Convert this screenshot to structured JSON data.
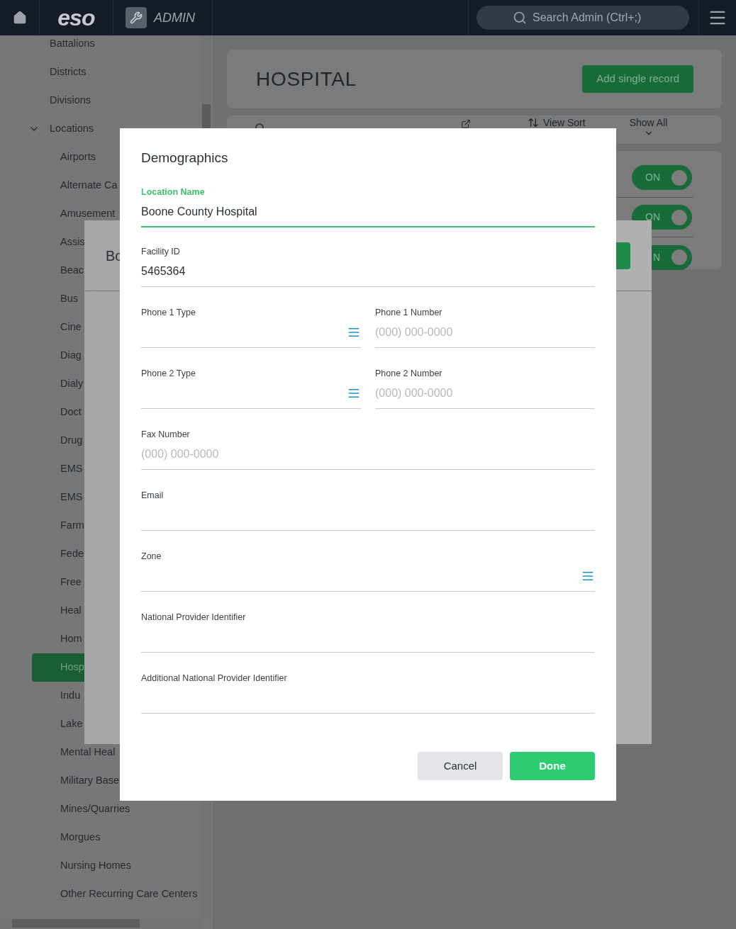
{
  "header": {
    "logo": "eso",
    "app_label": "ADMIN",
    "search": {
      "placeholder": "Search Admin (Ctrl+;)"
    }
  },
  "sidebar": {
    "items": [
      {
        "label": "Battalions",
        "selected": false
      },
      {
        "label": "Districts",
        "selected": false
      },
      {
        "label": "Divisions",
        "selected": false
      },
      {
        "label": "Locations",
        "selected": false,
        "expanded": true,
        "children": [
          {
            "label": "Airports",
            "selected": false
          },
          {
            "label": "Alternate Ca",
            "selected": false
          },
          {
            "label": "Amusement",
            "selected": false
          },
          {
            "label": "Assis",
            "selected": false
          },
          {
            "label": "Beac",
            "selected": false
          },
          {
            "label": "Bus",
            "selected": false
          },
          {
            "label": "Cine",
            "selected": false
          },
          {
            "label": "Diag",
            "selected": false
          },
          {
            "label": "Dialy",
            "selected": false
          },
          {
            "label": "Doct",
            "selected": false
          },
          {
            "label": "Drug",
            "selected": false
          },
          {
            "label": "EMS",
            "selected": false
          },
          {
            "label": "EMS",
            "selected": false
          },
          {
            "label": "Farm",
            "selected": false
          },
          {
            "label": "Fede",
            "selected": false
          },
          {
            "label": "Free",
            "selected": false
          },
          {
            "label": "Heal",
            "selected": false
          },
          {
            "label": "Hom",
            "selected": false
          },
          {
            "label": "Hosp",
            "selected": true
          },
          {
            "label": "Indu",
            "selected": false
          },
          {
            "label": "Lake",
            "selected": false
          },
          {
            "label": "Mental Heal",
            "selected": false
          },
          {
            "label": "Military Base",
            "selected": false
          },
          {
            "label": "Mines/Quarries",
            "selected": false
          },
          {
            "label": "Morgues",
            "selected": false
          },
          {
            "label": "Nursing Homes",
            "selected": false
          },
          {
            "label": "Other Recurring Care Centers",
            "selected": false
          }
        ]
      }
    ]
  },
  "page": {
    "title": "HOSPITAL",
    "add_button": "Add single record",
    "toolbar": {
      "view_sort": "View Sort",
      "show_all": "Show All"
    },
    "toggles": [
      {
        "label": "ON",
        "on": true
      },
      {
        "label": "ON",
        "on": true
      },
      {
        "label": "N",
        "on": true
      }
    ]
  },
  "background_dialog": {
    "title": "Bo"
  },
  "dialog": {
    "title": "Demographics",
    "rows": [
      [
        {
          "label": "Location Name",
          "kind": "text",
          "value": "Boone County Hospital",
          "focused": true
        }
      ],
      [
        {
          "label": "Facility ID",
          "kind": "text",
          "value": "5465364",
          "focused": false
        }
      ],
      [
        {
          "label": "Phone 1 Type",
          "kind": "select",
          "focused": false
        },
        {
          "label": "Phone 1 Number",
          "kind": "text",
          "placeholder": "(000) 000-0000",
          "focused": false
        }
      ],
      [
        {
          "label": "Phone 2 Type",
          "kind": "select",
          "focused": false
        },
        {
          "label": "Phone 2 Number",
          "kind": "text",
          "placeholder": "(000) 000-0000",
          "focused": false
        }
      ],
      [
        {
          "label": "Fax Number",
          "kind": "text",
          "placeholder": "(000) 000-0000",
          "focused": false
        }
      ],
      [
        {
          "label": "Email",
          "kind": "text",
          "focused": false
        }
      ],
      [
        {
          "label": "Zone",
          "kind": "select",
          "focused": false
        }
      ],
      [
        {
          "label": "National Provider Identifier",
          "kind": "text",
          "focused": false
        }
      ],
      [
        {
          "label": "Additional National Provider Identifier",
          "kind": "text",
          "focused": false
        }
      ]
    ],
    "buttons": {
      "cancel": "Cancel",
      "done": "Done"
    }
  }
}
